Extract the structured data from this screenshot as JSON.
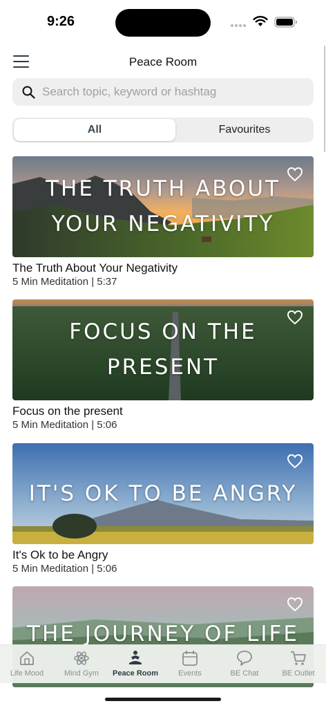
{
  "status_bar": {
    "time": "9:26"
  },
  "header": {
    "title": "Peace Room"
  },
  "search": {
    "placeholder": "Search topic, keyword or hashtag",
    "value": ""
  },
  "segments": {
    "all": "All",
    "favourites": "Favourites",
    "selected": "All"
  },
  "cards": [
    {
      "overlay_lines": [
        "THE TRUTH ABOUT",
        "YOUR NEGATIVITY"
      ],
      "title": "The Truth About Your Negativity",
      "subtitle": "5 Min Meditation | 5:37"
    },
    {
      "overlay_lines": [
        "FOCUS ON THE",
        "PRESENT"
      ],
      "title": "Focus on the present",
      "subtitle": "5 Min Meditation | 5:06"
    },
    {
      "overlay_lines": [
        "IT'S OK TO BE ANGRY"
      ],
      "title": "It's Ok to be Angry",
      "subtitle": "5 Min Meditation | 5:06"
    },
    {
      "overlay_lines": [
        "THE JOURNEY OF LIFE"
      ]
    }
  ],
  "tabs": [
    {
      "label": "Life Mood",
      "icon": "home-icon"
    },
    {
      "label": "Mind Gym",
      "icon": "brain-icon"
    },
    {
      "label": "Peace Room",
      "icon": "meditation-icon",
      "active": true
    },
    {
      "label": "Events",
      "icon": "calendar-icon"
    },
    {
      "label": "BE Chat",
      "icon": "chat-icon"
    },
    {
      "label": "BE Outlet",
      "icon": "cart-icon"
    }
  ],
  "colors": {
    "accent": "#2e3b44",
    "inactive_tab": "#8a8f94",
    "search_bg": "#efefef"
  }
}
